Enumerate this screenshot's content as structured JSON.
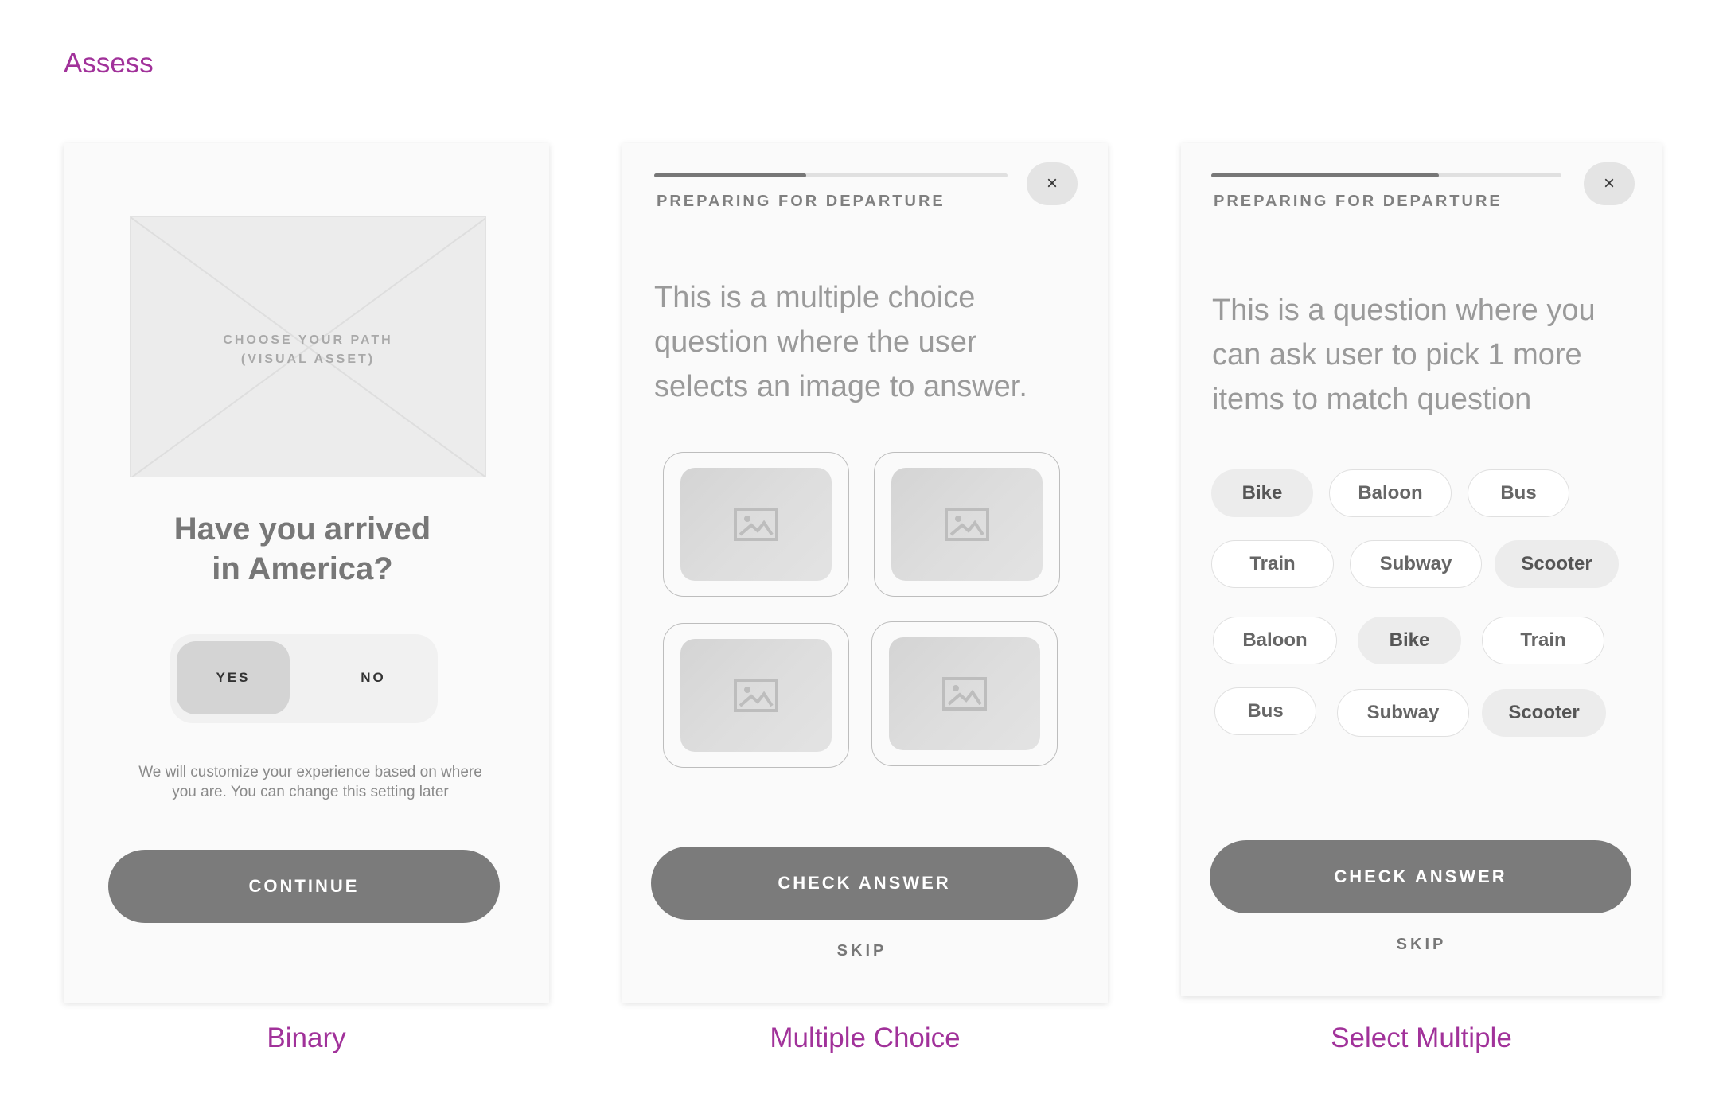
{
  "section_title": "Assess",
  "binary": {
    "label": "Binary",
    "asset_line1": "CHOOSE YOUR PATH",
    "asset_line2": "(VISUAL ASSET)",
    "question_line1": "Have you arrived",
    "question_line2": "in America?",
    "yes_label": "YES",
    "no_label": "NO",
    "selected": "YES",
    "helper_line1": "We will customize your experience based on where",
    "helper_line2": "you are.  You can change this setting later",
    "continue_label": "CONTINUE"
  },
  "multiple_choice": {
    "label": "Multiple Choice",
    "eyebrow": "PREPARING FOR DEPARTURE",
    "progress": 0.43,
    "close_icon": "×",
    "question_line1": "This is a multiple choice",
    "question_line2": "question where the user",
    "question_line3": "selects an image to answer.",
    "options": [
      "image-option-1",
      "image-option-2",
      "image-option-3",
      "image-option-4"
    ],
    "check_label": "CHECK ANSWER",
    "skip_label": "SKIP"
  },
  "select_multiple": {
    "label": "Select Multiple",
    "eyebrow": "PREPARING FOR DEPARTURE",
    "progress": 0.65,
    "close_icon": "×",
    "question_line1": "This is a question where you",
    "question_line2": "can ask user to pick 1 more",
    "question_line3": "items to match question",
    "chips": [
      {
        "label": "Bike",
        "selected": true
      },
      {
        "label": "Baloon",
        "selected": false
      },
      {
        "label": "Bus",
        "selected": false
      },
      {
        "label": "Train",
        "selected": false
      },
      {
        "label": "Subway",
        "selected": false
      },
      {
        "label": "Scooter",
        "selected": true
      },
      {
        "label": "Baloon",
        "selected": false
      },
      {
        "label": "Bike",
        "selected": true
      },
      {
        "label": "Train",
        "selected": false
      },
      {
        "label": "Bus",
        "selected": false
      },
      {
        "label": "Subway",
        "selected": false
      },
      {
        "label": "Scooter",
        "selected": true
      }
    ],
    "check_label": "CHECK ANSWER",
    "skip_label": "SKIP"
  }
}
